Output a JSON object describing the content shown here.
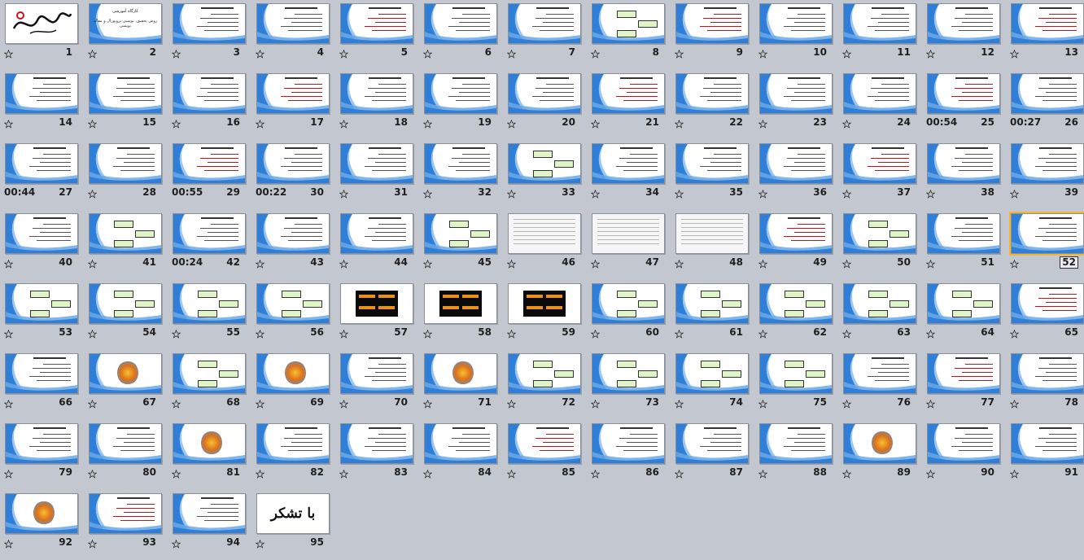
{
  "slides": [
    {
      "num": "1",
      "style": "calligraphy"
    },
    {
      "num": "2",
      "style": "title",
      "title": "کارگاه آموزشی",
      "subtitle": "روش تحقیق، نویسی پروپوزال و مقاله نویسی"
    },
    {
      "num": "3",
      "style": "text"
    },
    {
      "num": "4",
      "style": "text"
    },
    {
      "num": "5",
      "style": "text"
    },
    {
      "num": "6",
      "style": "text"
    },
    {
      "num": "7",
      "style": "text"
    },
    {
      "num": "8",
      "style": "diagram"
    },
    {
      "num": "9",
      "style": "text"
    },
    {
      "num": "10",
      "style": "text"
    },
    {
      "num": "11",
      "style": "text"
    },
    {
      "num": "12",
      "style": "text"
    },
    {
      "num": "13",
      "style": "text"
    },
    {
      "num": "14",
      "style": "text"
    },
    {
      "num": "15",
      "style": "text"
    },
    {
      "num": "16",
      "style": "text"
    },
    {
      "num": "17",
      "style": "text"
    },
    {
      "num": "18",
      "style": "text"
    },
    {
      "num": "19",
      "style": "text"
    },
    {
      "num": "20",
      "style": "text"
    },
    {
      "num": "21",
      "style": "text"
    },
    {
      "num": "22",
      "style": "text"
    },
    {
      "num": "23",
      "style": "text"
    },
    {
      "num": "24",
      "style": "text"
    },
    {
      "num": "25",
      "style": "text",
      "timing": "00:54"
    },
    {
      "num": "26",
      "style": "text",
      "timing": "00:27"
    },
    {
      "num": "27",
      "style": "text",
      "timing": "00:44"
    },
    {
      "num": "28",
      "style": "text"
    },
    {
      "num": "29",
      "style": "text",
      "timing": "00:55"
    },
    {
      "num": "30",
      "style": "text",
      "timing": "00:22"
    },
    {
      "num": "31",
      "style": "text"
    },
    {
      "num": "32",
      "style": "text"
    },
    {
      "num": "33",
      "style": "diagram"
    },
    {
      "num": "34",
      "style": "text"
    },
    {
      "num": "35",
      "style": "text"
    },
    {
      "num": "36",
      "style": "text"
    },
    {
      "num": "37",
      "style": "text"
    },
    {
      "num": "38",
      "style": "text"
    },
    {
      "num": "39",
      "style": "text"
    },
    {
      "num": "40",
      "style": "text"
    },
    {
      "num": "41",
      "style": "diagram"
    },
    {
      "num": "42",
      "style": "text",
      "timing": "00:24"
    },
    {
      "num": "43",
      "style": "text"
    },
    {
      "num": "44",
      "style": "text"
    },
    {
      "num": "45",
      "style": "diagram"
    },
    {
      "num": "46",
      "style": "scan"
    },
    {
      "num": "47",
      "style": "scan"
    },
    {
      "num": "48",
      "style": "scan"
    },
    {
      "num": "49",
      "style": "text"
    },
    {
      "num": "50",
      "style": "diagram"
    },
    {
      "num": "51",
      "style": "text"
    },
    {
      "num": "52",
      "style": "text",
      "selected": true
    },
    {
      "num": "53",
      "style": "diagram"
    },
    {
      "num": "54",
      "style": "diagram"
    },
    {
      "num": "55",
      "style": "diagram"
    },
    {
      "num": "56",
      "style": "diagram"
    },
    {
      "num": "57",
      "style": "dark"
    },
    {
      "num": "58",
      "style": "dark"
    },
    {
      "num": "59",
      "style": "dark"
    },
    {
      "num": "60",
      "style": "diagram"
    },
    {
      "num": "61",
      "style": "diagram"
    },
    {
      "num": "62",
      "style": "diagram"
    },
    {
      "num": "63",
      "style": "diagram"
    },
    {
      "num": "64",
      "style": "diagram"
    },
    {
      "num": "65",
      "style": "text"
    },
    {
      "num": "66",
      "style": "text"
    },
    {
      "num": "67",
      "style": "figure"
    },
    {
      "num": "68",
      "style": "diagram"
    },
    {
      "num": "69",
      "style": "figure"
    },
    {
      "num": "70",
      "style": "text"
    },
    {
      "num": "71",
      "style": "figure"
    },
    {
      "num": "72",
      "style": "diagram"
    },
    {
      "num": "73",
      "style": "diagram"
    },
    {
      "num": "74",
      "style": "diagram"
    },
    {
      "num": "75",
      "style": "diagram"
    },
    {
      "num": "76",
      "style": "text"
    },
    {
      "num": "77",
      "style": "text"
    },
    {
      "num": "78",
      "style": "text"
    },
    {
      "num": "79",
      "style": "text"
    },
    {
      "num": "80",
      "style": "text"
    },
    {
      "num": "81",
      "style": "figure"
    },
    {
      "num": "82",
      "style": "text"
    },
    {
      "num": "83",
      "style": "text"
    },
    {
      "num": "84",
      "style": "text"
    },
    {
      "num": "85",
      "style": "text"
    },
    {
      "num": "86",
      "style": "text"
    },
    {
      "num": "87",
      "style": "text"
    },
    {
      "num": "88",
      "style": "text"
    },
    {
      "num": "89",
      "style": "figure"
    },
    {
      "num": "90",
      "style": "text"
    },
    {
      "num": "91",
      "style": "text"
    },
    {
      "num": "92",
      "style": "figure"
    },
    {
      "num": "93",
      "style": "text"
    },
    {
      "num": "94",
      "style": "text"
    },
    {
      "num": "95",
      "style": "thanks",
      "text": "با تشکر"
    }
  ],
  "icons": {
    "star": "star-icon"
  },
  "colors": {
    "background": "#c3c8d0",
    "wave": "#2f7fd8",
    "selected": "#f2b630"
  }
}
